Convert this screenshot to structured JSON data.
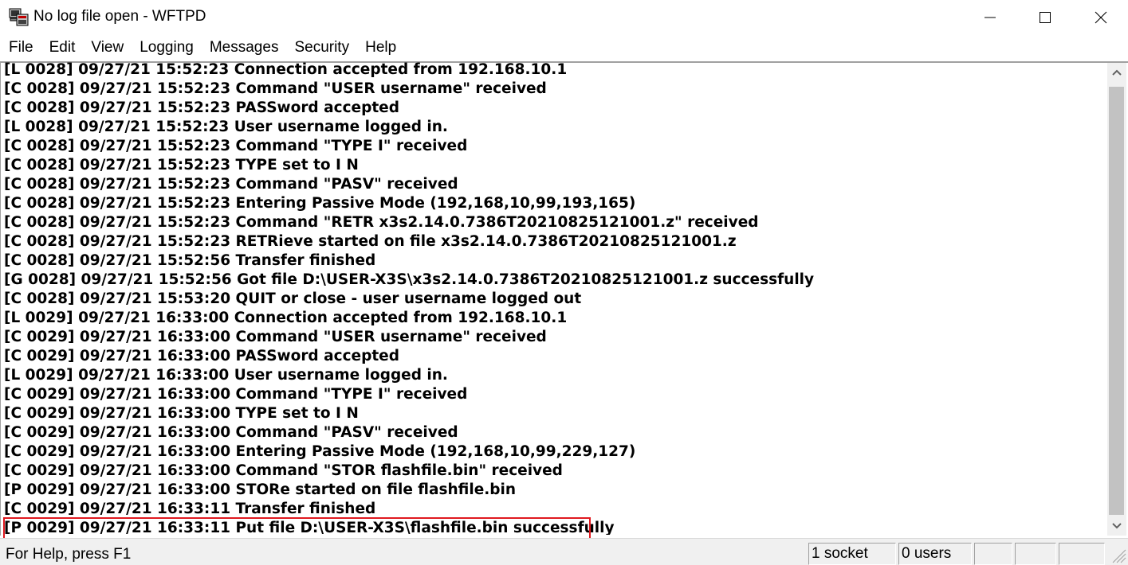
{
  "window": {
    "title": "No log file open - WFTPD",
    "app_icon": "wftpd-app-icon",
    "controls": [
      "minimize-icon",
      "maximize-icon",
      "close-icon"
    ]
  },
  "menu": {
    "items": [
      "File",
      "Edit",
      "View",
      "Logging",
      "Messages",
      "Security",
      "Help"
    ]
  },
  "log": {
    "lines": [
      "[L 0028] 09/27/21 15:52:23 Connection accepted from 192.168.10.1",
      "[C 0028] 09/27/21 15:52:23 Command \"USER username\" received",
      "[C 0028] 09/27/21 15:52:23 PASSword accepted",
      "[L 0028] 09/27/21 15:52:23 User username logged in.",
      "[C 0028] 09/27/21 15:52:23 Command \"TYPE I\" received",
      "[C 0028] 09/27/21 15:52:23 TYPE set to I N",
      "[C 0028] 09/27/21 15:52:23 Command \"PASV\" received",
      "[C 0028] 09/27/21 15:52:23 Entering Passive Mode (192,168,10,99,193,165)",
      "[C 0028] 09/27/21 15:52:23 Command \"RETR x3s2.14.0.7386T20210825121001.z\" received",
      "[C 0028] 09/27/21 15:52:23 RETRieve started on file x3s2.14.0.7386T20210825121001.z",
      "[C 0028] 09/27/21 15:52:56 Transfer finished",
      "[G 0028] 09/27/21 15:52:56 Got file D:\\USER-X3S\\x3s2.14.0.7386T20210825121001.z successfully",
      "[C 0028] 09/27/21 15:53:20 QUIT or close - user username logged out",
      "[L 0029] 09/27/21 16:33:00 Connection accepted from 192.168.10.1",
      "[C 0029] 09/27/21 16:33:00 Command \"USER username\" received",
      "[C 0029] 09/27/21 16:33:00 PASSword accepted",
      "[L 0029] 09/27/21 16:33:00 User username logged in.",
      "[C 0029] 09/27/21 16:33:00 Command \"TYPE I\" received",
      "[C 0029] 09/27/21 16:33:00 TYPE set to I N",
      "[C 0029] 09/27/21 16:33:00 Command \"PASV\" received",
      "[C 0029] 09/27/21 16:33:00 Entering Passive Mode (192,168,10,99,229,127)",
      "[C 0029] 09/27/21 16:33:00 Command \"STOR flashfile.bin\" received",
      "[P 0029] 09/27/21 16:33:00 STORe started on file flashfile.bin",
      "[C 0029] 09/27/21 16:33:11 Transfer finished",
      "[P 0029] 09/27/21 16:33:11 Put file D:\\USER-X3S\\flashfile.bin successfully"
    ],
    "highlight_color": "#e0191f"
  },
  "status": {
    "help": "For Help, press F1",
    "sockets": "1 socket",
    "users": "0 users"
  }
}
